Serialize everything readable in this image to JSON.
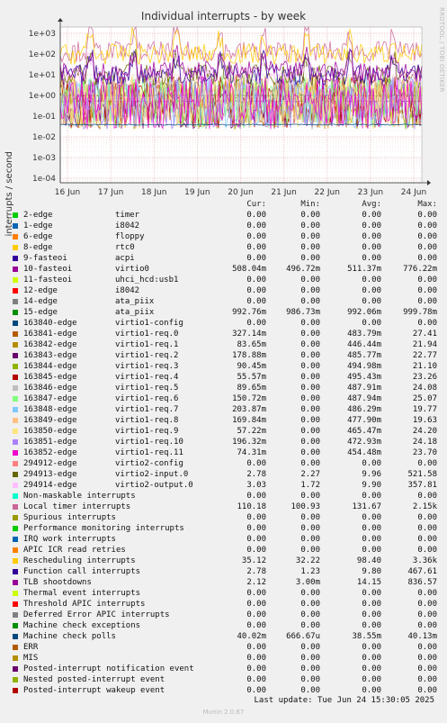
{
  "chart_data": {
    "type": "line",
    "title": "Individual interrupts - by week",
    "ylabel": "interrupts / second",
    "yscale": "log",
    "ylim": [
      6e-05,
      2000
    ],
    "yticks": [
      "1e+03",
      "1e+02",
      "1e+01",
      "1e+00",
      "1e-01",
      "1e-02",
      "1e-03",
      "1e-04"
    ],
    "x_ticks": [
      "16 Jun",
      "17 Jun",
      "18 Jun",
      "19 Jun",
      "20 Jun",
      "21 Jun",
      "22 Jun",
      "23 Jun",
      "24 Jun"
    ],
    "side_credit": "RRDTOOL / TOBI OETIKER",
    "grid": true,
    "columns": [
      "Cur:",
      "Min:",
      "Avg:",
      "Max:"
    ],
    "series": [
      {
        "name": "2-edge",
        "sub": "timer",
        "color": "#00cc00",
        "cur": "0.00",
        "min": "0.00",
        "avg": "0.00",
        "max": "0.00"
      },
      {
        "name": "1-edge",
        "sub": "i8042",
        "color": "#0066b3",
        "cur": "0.00",
        "min": "0.00",
        "avg": "0.00",
        "max": "0.00"
      },
      {
        "name": "6-edge",
        "sub": "floppy",
        "color": "#ff8000",
        "cur": "0.00",
        "min": "0.00",
        "avg": "0.00",
        "max": "0.00"
      },
      {
        "name": "8-edge",
        "sub": "rtc0",
        "color": "#ffcc00",
        "cur": "0.00",
        "min": "0.00",
        "avg": "0.00",
        "max": "0.00"
      },
      {
        "name": "9-fasteoi",
        "sub": "acpi",
        "color": "#330099",
        "cur": "0.00",
        "min": "0.00",
        "avg": "0.00",
        "max": "0.00"
      },
      {
        "name": "10-fasteoi",
        "sub": "virtio0",
        "color": "#990099",
        "cur": "508.04m",
        "min": "496.72m",
        "avg": "511.37m",
        "max": "776.22m"
      },
      {
        "name": "11-fasteoi",
        "sub": "uhci_hcd:usb1",
        "color": "#ccff00",
        "cur": "0.00",
        "min": "0.00",
        "avg": "0.00",
        "max": "0.00"
      },
      {
        "name": "12-edge",
        "sub": "i8042",
        "color": "#ff0000",
        "cur": "0.00",
        "min": "0.00",
        "avg": "0.00",
        "max": "0.00"
      },
      {
        "name": "14-edge",
        "sub": "ata_piix",
        "color": "#808080",
        "cur": "0.00",
        "min": "0.00",
        "avg": "0.00",
        "max": "0.00"
      },
      {
        "name": "15-edge",
        "sub": "ata_piix",
        "color": "#008f00",
        "cur": "992.76m",
        "min": "986.73m",
        "avg": "992.06m",
        "max": "999.78m"
      },
      {
        "name": "163840-edge",
        "sub": "virtio1-config",
        "color": "#00487d",
        "cur": "0.00",
        "min": "0.00",
        "avg": "0.00",
        "max": "0.00"
      },
      {
        "name": "163841-edge",
        "sub": "virtio1-req.0",
        "color": "#b35a00",
        "cur": "327.14m",
        "min": "0.00",
        "avg": "483.79m",
        "max": "27.41"
      },
      {
        "name": "163842-edge",
        "sub": "virtio1-req.1",
        "color": "#b38f00",
        "cur": "83.65m",
        "min": "0.00",
        "avg": "446.44m",
        "max": "21.94"
      },
      {
        "name": "163843-edge",
        "sub": "virtio1-req.2",
        "color": "#6b006b",
        "cur": "178.88m",
        "min": "0.00",
        "avg": "485.77m",
        "max": "22.77"
      },
      {
        "name": "163844-edge",
        "sub": "virtio1-req.3",
        "color": "#8fb300",
        "cur": "90.45m",
        "min": "0.00",
        "avg": "494.98m",
        "max": "21.10"
      },
      {
        "name": "163845-edge",
        "sub": "virtio1-req.4",
        "color": "#b30000",
        "cur": "55.57m",
        "min": "0.00",
        "avg": "495.43m",
        "max": "23.26"
      },
      {
        "name": "163846-edge",
        "sub": "virtio1-req.5",
        "color": "#bebebe",
        "cur": "89.65m",
        "min": "0.00",
        "avg": "487.91m",
        "max": "24.08"
      },
      {
        "name": "163847-edge",
        "sub": "virtio1-req.6",
        "color": "#80ff80",
        "cur": "150.72m",
        "min": "0.00",
        "avg": "487.94m",
        "max": "25.07"
      },
      {
        "name": "163848-edge",
        "sub": "virtio1-req.7",
        "color": "#80c9ff",
        "cur": "203.87m",
        "min": "0.00",
        "avg": "486.29m",
        "max": "19.77"
      },
      {
        "name": "163849-edge",
        "sub": "virtio1-req.8",
        "color": "#ffc080",
        "cur": "169.84m",
        "min": "0.00",
        "avg": "477.90m",
        "max": "19.63"
      },
      {
        "name": "163850-edge",
        "sub": "virtio1-req.9",
        "color": "#ffe680",
        "cur": "57.22m",
        "min": "0.00",
        "avg": "465.47m",
        "max": "24.20"
      },
      {
        "name": "163851-edge",
        "sub": "virtio1-req.10",
        "color": "#aa80ff",
        "cur": "196.32m",
        "min": "0.00",
        "avg": "472.93m",
        "max": "24.18"
      },
      {
        "name": "163852-edge",
        "sub": "virtio1-req.11",
        "color": "#ee00cc",
        "cur": "74.31m",
        "min": "0.00",
        "avg": "454.48m",
        "max": "23.70"
      },
      {
        "name": "294912-edge",
        "sub": "virtio2-config",
        "color": "#ff8080",
        "cur": "0.00",
        "min": "0.00",
        "avg": "0.00",
        "max": "0.00"
      },
      {
        "name": "294913-edge",
        "sub": "virtio2-input.0",
        "color": "#666600",
        "cur": "2.78",
        "min": "2.27",
        "avg": "9.96",
        "max": "521.58"
      },
      {
        "name": "294914-edge",
        "sub": "virtio2-output.0",
        "color": "#ffbfff",
        "cur": "3.03",
        "min": "1.72",
        "avg": "9.90",
        "max": "357.81"
      },
      {
        "name": "Non-maskable interrupts",
        "sub": "",
        "color": "#00ffcc",
        "cur": "0.00",
        "min": "0.00",
        "avg": "0.00",
        "max": "0.00"
      },
      {
        "name": "Local timer interrupts",
        "sub": "",
        "color": "#cc6699",
        "cur": "110.18",
        "min": "100.93",
        "avg": "131.67",
        "max": "2.15k"
      },
      {
        "name": "Spurious interrupts",
        "sub": "",
        "color": "#999900",
        "cur": "0.00",
        "min": "0.00",
        "avg": "0.00",
        "max": "0.00"
      },
      {
        "name": "Performance monitoring interrupts",
        "sub": "",
        "color": "#00cc00",
        "cur": "0.00",
        "min": "0.00",
        "avg": "0.00",
        "max": "0.00"
      },
      {
        "name": "IRQ work interrupts",
        "sub": "",
        "color": "#0066b3",
        "cur": "0.00",
        "min": "0.00",
        "avg": "0.00",
        "max": "0.00"
      },
      {
        "name": "APIC ICR read retries",
        "sub": "",
        "color": "#ff8000",
        "cur": "0.00",
        "min": "0.00",
        "avg": "0.00",
        "max": "0.00"
      },
      {
        "name": "Rescheduling interrupts",
        "sub": "",
        "color": "#ffcc00",
        "cur": "35.12",
        "min": "32.22",
        "avg": "98.40",
        "max": "3.36k"
      },
      {
        "name": "Function call interrupts",
        "sub": "",
        "color": "#330099",
        "cur": "2.78",
        "min": "1.23",
        "avg": "9.80",
        "max": "467.61"
      },
      {
        "name": "TLB shootdowns",
        "sub": "",
        "color": "#990099",
        "cur": "2.12",
        "min": "3.00m",
        "avg": "14.15",
        "max": "836.57"
      },
      {
        "name": "Thermal event interrupts",
        "sub": "",
        "color": "#ccff00",
        "cur": "0.00",
        "min": "0.00",
        "avg": "0.00",
        "max": "0.00"
      },
      {
        "name": "Threshold APIC interrupts",
        "sub": "",
        "color": "#ff0000",
        "cur": "0.00",
        "min": "0.00",
        "avg": "0.00",
        "max": "0.00"
      },
      {
        "name": "Deferred Error APIC interrupts",
        "sub": "",
        "color": "#808080",
        "cur": "0.00",
        "min": "0.00",
        "avg": "0.00",
        "max": "0.00"
      },
      {
        "name": "Machine check exceptions",
        "sub": "",
        "color": "#008f00",
        "cur": "0.00",
        "min": "0.00",
        "avg": "0.00",
        "max": "0.00"
      },
      {
        "name": "Machine check polls",
        "sub": "",
        "color": "#00487d",
        "cur": "40.02m",
        "min": "666.67u",
        "avg": "38.55m",
        "max": "40.13m"
      },
      {
        "name": "ERR",
        "sub": "",
        "color": "#b35a00",
        "cur": "0.00",
        "min": "0.00",
        "avg": "0.00",
        "max": "0.00"
      },
      {
        "name": "MIS",
        "sub": "",
        "color": "#b38f00",
        "cur": "0.00",
        "min": "0.00",
        "avg": "0.00",
        "max": "0.00"
      },
      {
        "name": "Posted-interrupt notification event",
        "sub": "",
        "color": "#6b006b",
        "cur": "0.00",
        "min": "0.00",
        "avg": "0.00",
        "max": "0.00"
      },
      {
        "name": "Nested posted-interrupt event",
        "sub": "",
        "color": "#8fb300",
        "cur": "0.00",
        "min": "0.00",
        "avg": "0.00",
        "max": "0.00"
      },
      {
        "name": "Posted-interrupt wakeup event",
        "sub": "",
        "color": "#b30000",
        "cur": "0.00",
        "min": "0.00",
        "avg": "0.00",
        "max": "0.00"
      }
    ],
    "last_update": "Last update: Tue Jun 24 15:30:05 2025",
    "footer": "Munin 2.0.67"
  }
}
